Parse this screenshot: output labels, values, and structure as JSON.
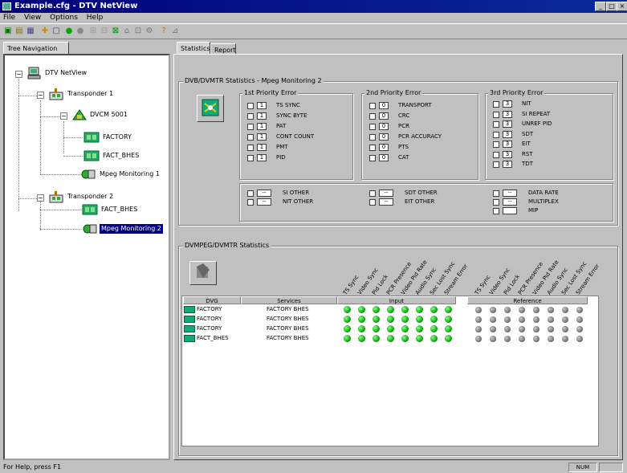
{
  "window": {
    "title": "Example.cfg - DTV NetView"
  },
  "menu": [
    "File",
    "View",
    "Options",
    "Help"
  ],
  "left_tab": "Tree Navigation",
  "right_tabs": [
    "Statistics",
    "Report"
  ],
  "tree": [
    {
      "label": "DTV NetView",
      "icon": "computer-icon"
    },
    {
      "label": "Transponder 1",
      "icon": "transponder-icon"
    },
    {
      "label": "DVCM 5001",
      "icon": "encoder-icon"
    },
    {
      "label": "FACTORY",
      "icon": "service-icon"
    },
    {
      "label": "FACT_BHES",
      "icon": "service-icon"
    },
    {
      "label": "Mpeg Monitoring 1",
      "icon": "monitor-icon"
    },
    {
      "label": "Transponder 2",
      "icon": "transponder-icon"
    },
    {
      "label": "FACT_BHES",
      "icon": "service-icon"
    },
    {
      "label": "Mpeg Monitoring 2",
      "icon": "monitor-icon"
    }
  ],
  "dvb_stats": {
    "title": "DVB/DVMTR Statistics - Mpeg Monitoring 2",
    "p1": {
      "title": "1st Priority Error",
      "rows": [
        {
          "value": "1",
          "label": "TS SYNC"
        },
        {
          "value": "1",
          "label": "SYNC BYTE"
        },
        {
          "value": "1",
          "label": "PAT"
        },
        {
          "value": "1",
          "label": "CONT COUNT"
        },
        {
          "value": "1",
          "label": "PMT"
        },
        {
          "value": "1",
          "label": "PID"
        }
      ]
    },
    "p2": {
      "title": "2nd Priority Error",
      "rows": [
        {
          "value": "0",
          "label": "TRANSPORT"
        },
        {
          "value": "0",
          "label": "CRC"
        },
        {
          "value": "0",
          "label": "PCR"
        },
        {
          "value": "0",
          "label": "PCR ACCURACY"
        },
        {
          "value": "0",
          "label": "PTS"
        },
        {
          "value": "0",
          "label": "CAT"
        }
      ]
    },
    "p3": {
      "title": "3rd Priority Error",
      "rows": [
        {
          "value": "3",
          "label": "NIT"
        },
        {
          "value": "3",
          "label": "SI REPEAT"
        },
        {
          "value": "3",
          "label": "UNREF PID"
        },
        {
          "value": "3",
          "label": "SDT"
        },
        {
          "value": "3",
          "label": "EIT"
        },
        {
          "value": "3",
          "label": "RST"
        },
        {
          "value": "3",
          "label": "TDT"
        }
      ]
    },
    "other": {
      "c1": [
        {
          "value": "--",
          "label": "SI OTHER"
        },
        {
          "value": "--",
          "label": "NIT OTHER"
        }
      ],
      "c2": [
        {
          "value": "--",
          "label": "SDT OTHER"
        },
        {
          "value": "--",
          "label": "EIT OTHER"
        }
      ],
      "c3": [
        {
          "value": "--",
          "label": "DATA RATE"
        },
        {
          "value": "--",
          "label": "MULTIPLEX"
        },
        {
          "value": "",
          "label": "MIP"
        }
      ]
    }
  },
  "dvmpeg": {
    "title": "DVMPEG/DVMTR Statistics",
    "col_dvg": "DVG",
    "col_services": "Services",
    "col_input": "Input",
    "col_reference": "Reference",
    "indicator_headers": [
      "TS Sync",
      "Video Sync",
      "Pid Lock",
      "PCR Presence",
      "Video Pid Rate",
      "Audio Sync",
      "Sec Lost Sync",
      "Stream Error"
    ],
    "reference_headers": [
      "TS Sync",
      "Video Sync",
      "Pid Lock",
      "PCR Presence",
      "Video Pid Rate",
      "Audio Sync",
      "Sec Lost Sync",
      "Stream Error"
    ],
    "rows": [
      {
        "dvg": "FACTORY",
        "service": "FACTORY BHES"
      },
      {
        "dvg": "FACTORY",
        "service": "FACTORY BHES"
      },
      {
        "dvg": "FACTORY",
        "service": "FACTORY BHES"
      },
      {
        "dvg": "FACT_BHES",
        "service": "FACTORY BHES"
      }
    ],
    "input_color": "#22aa22",
    "reference_color": "#777777"
  },
  "status": {
    "help": "For Help, press F1",
    "mode": "NUM"
  }
}
